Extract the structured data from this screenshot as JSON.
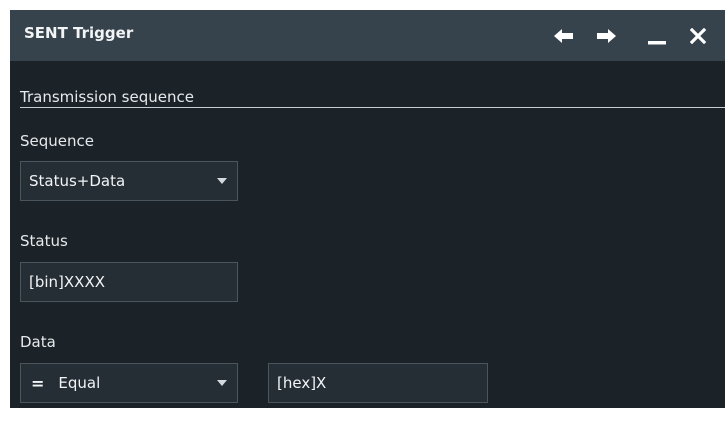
{
  "window": {
    "title": "SENT Trigger",
    "buttons": {
      "back_icon": "left-arrow-icon",
      "forward_icon": "right-arrow-icon",
      "minimize_icon": "minimize-icon",
      "close_icon": "close-icon"
    }
  },
  "section": {
    "header": "Transmission sequence"
  },
  "sequence": {
    "label": "Sequence",
    "value": "Status+Data"
  },
  "status": {
    "label": "Status",
    "value": "[bin]XXXX"
  },
  "data": {
    "label": "Data",
    "operator_symbol": "=",
    "operator_value": "Equal",
    "value": "[hex]X"
  },
  "colors": {
    "dialog_background": "#1c2328",
    "titlebar_background": "#36434c",
    "field_background": "#262e35",
    "field_border": "#4a555e",
    "text": "#e6e9ec"
  }
}
